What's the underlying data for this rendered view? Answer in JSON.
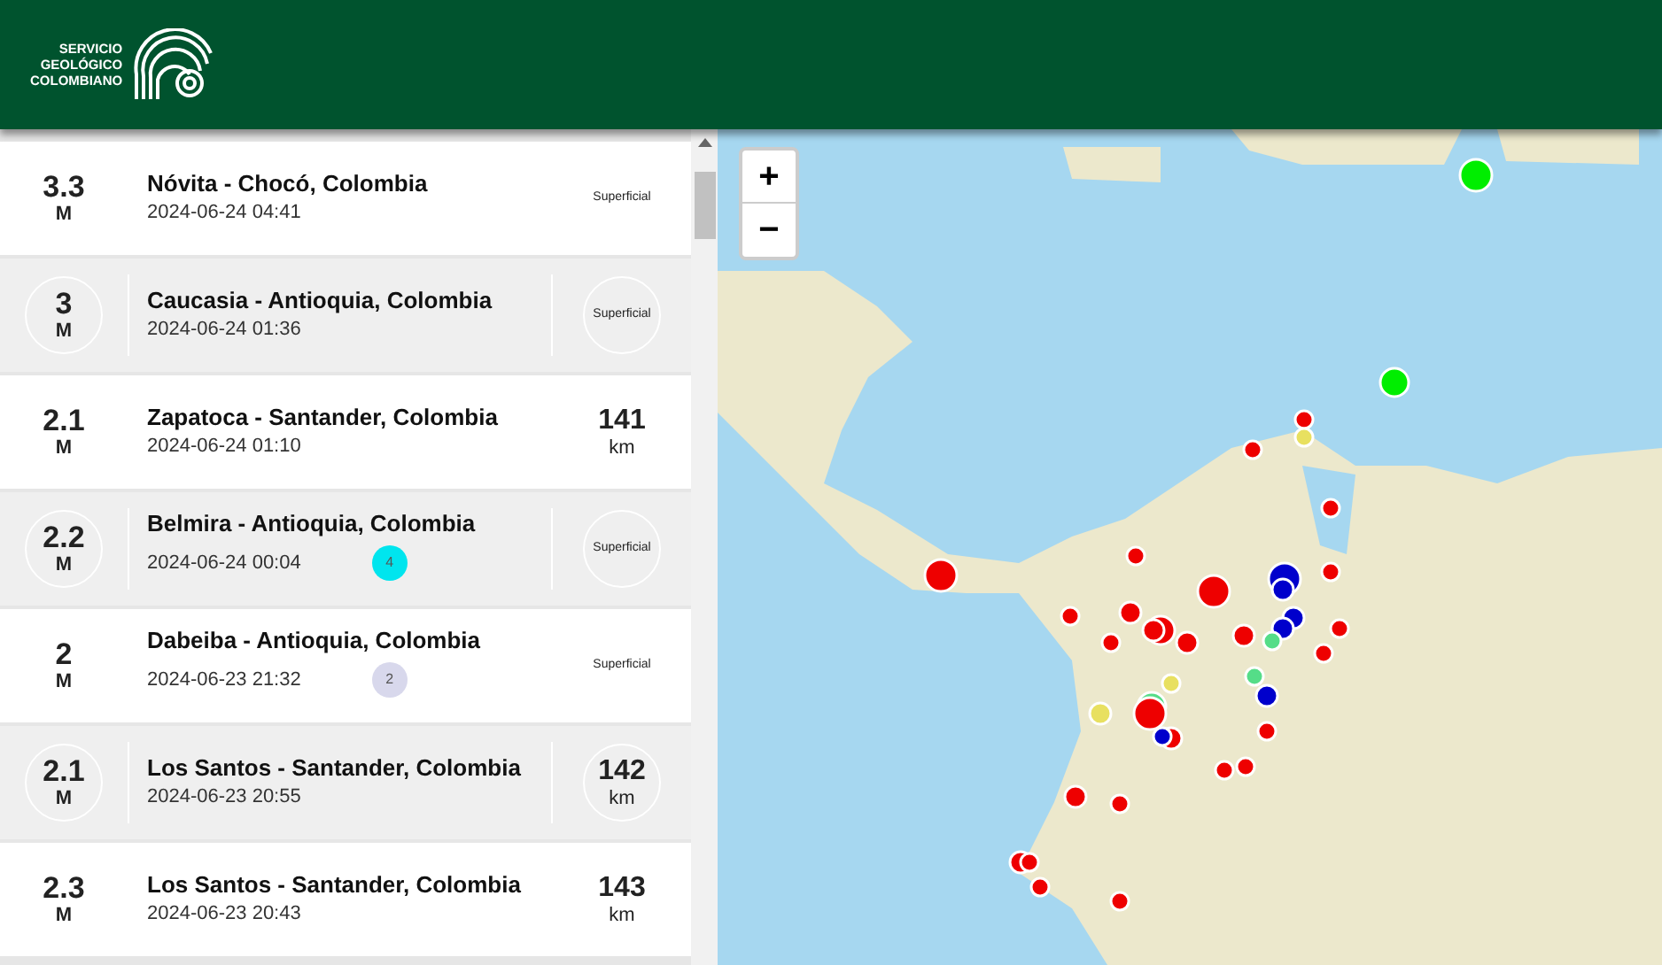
{
  "header": {
    "logo_lines": [
      "SERVICIO",
      "GEOLÓGICO",
      "COLOMBIANO"
    ]
  },
  "events": [
    {
      "magnitude": "3.3",
      "unit": "M",
      "place": "Nóvita - Chocó, Colombia",
      "time": "2024-06-24 04:41",
      "depth": "Superficial",
      "kind": "shallow",
      "highlighted": false
    },
    {
      "magnitude": "3",
      "unit": "M",
      "place": "Caucasia - Antioquia, Colombia",
      "time": "2024-06-24 01:36",
      "depth": "Superficial",
      "kind": "shallow",
      "highlighted": true
    },
    {
      "magnitude": "2.1",
      "unit": "M",
      "place": "Zapatoca - Santander, Colombia",
      "time": "2024-06-24 01:10",
      "depth": "141",
      "depth_unit": "km",
      "kind": "deep",
      "highlighted": false
    },
    {
      "magnitude": "2.2",
      "unit": "M",
      "place": "Belmira - Antioquia, Colombia",
      "time": "2024-06-24 00:04",
      "depth": "Superficial",
      "kind": "shallow",
      "highlighted": true,
      "badge": {
        "count": "4",
        "color": "#00e5ee"
      }
    },
    {
      "magnitude": "2",
      "unit": "M",
      "place": "Dabeiba - Antioquia, Colombia",
      "time": "2024-06-23 21:32",
      "depth": "Superficial",
      "kind": "shallow",
      "highlighted": false,
      "badge": {
        "count": "2",
        "color": "#d8d8ec"
      }
    },
    {
      "magnitude": "2.1",
      "unit": "M",
      "place": "Los Santos - Santander, Colombia",
      "time": "2024-06-23 20:55",
      "depth": "142",
      "depth_unit": "km",
      "kind": "deep",
      "highlighted": true
    },
    {
      "magnitude": "2.3",
      "unit": "M",
      "place": "Los Santos - Santander, Colombia",
      "time": "2024-06-23 20:43",
      "depth": "143",
      "depth_unit": "km",
      "kind": "deep",
      "highlighted": false
    }
  ],
  "map": {
    "zoom_in": "+",
    "zoom_out": "−"
  }
}
